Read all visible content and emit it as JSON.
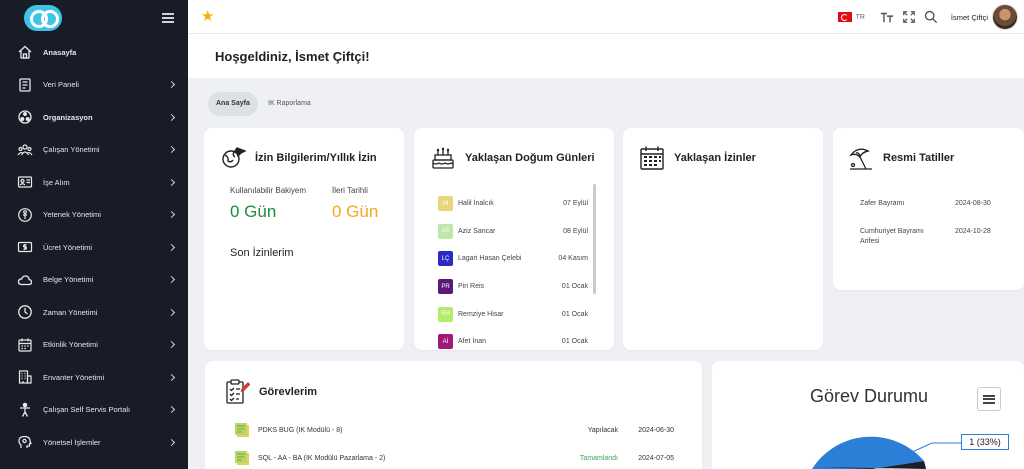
{
  "sidebar": {
    "items": [
      {
        "label": "Anasayfa",
        "icon": "home-icon"
      },
      {
        "label": "Veri Paneli",
        "icon": "dashboard-icon"
      },
      {
        "label": "Organizasyon",
        "icon": "organization-icon"
      },
      {
        "label": "Çalışan Yönetimi",
        "icon": "employees-icon"
      },
      {
        "label": "İşe Alım",
        "icon": "id-card-icon"
      },
      {
        "label": "Yetenek Yönetimi",
        "icon": "talent-icon"
      },
      {
        "label": "Ücret Yönetimi",
        "icon": "money-icon"
      },
      {
        "label": "Belge Yönetimi",
        "icon": "cloud-icon"
      },
      {
        "label": "Zaman Yönetimi",
        "icon": "clock-icon"
      },
      {
        "label": "Etkinlik Yönetimi",
        "icon": "calendar-icon"
      },
      {
        "label": "Envanter Yönetimi",
        "icon": "building-icon"
      },
      {
        "label": "Çalışan Self Servis Portalı",
        "icon": "person-icon"
      },
      {
        "label": "Yönetsel İşlemler",
        "icon": "settings-brain-icon"
      }
    ]
  },
  "topbar": {
    "lang": "TR",
    "user_name": "İsmet Çiftçi"
  },
  "welcome": "Hoşgeldiniz, İsmet Çiftçi!",
  "tabs": [
    "Ana Sayfa",
    "IK Raporlama"
  ],
  "leave": {
    "title": "İzin Bilgilerim/Yıllık İzin",
    "available_label": "Kullanılabilir Bakiyem",
    "available_value": "0 Gün",
    "future_label": "İleri Tarihli",
    "future_value": "0 Gün",
    "recent_title": "Son İzinlerim",
    "available_color": "#1e8e3e",
    "future_color": "#f5a623"
  },
  "birthdays": {
    "title": "Yaklaşan Doğum Günleri",
    "items": [
      {
        "initials": "Hİ",
        "name": "Halil İnalcık",
        "date": "07 Eylül",
        "color": "#e8d77a"
      },
      {
        "initials": "AS",
        "name": "Aziz Sancar",
        "date": "08 Eylül",
        "color": "#bfe8a8"
      },
      {
        "initials": "LÇ",
        "name": "Lagari Hasan Çelebi",
        "date": "04 Kasım",
        "color": "#2b2bc4"
      },
      {
        "initials": "PR",
        "name": "Piri Reis",
        "date": "01 Ocak",
        "color": "#5b1a78"
      },
      {
        "initials": "RH",
        "name": "Remziye Hisar",
        "date": "01 Ocak",
        "color": "#b6ec6a"
      },
      {
        "initials": "Aİ",
        "name": "Afet İnan",
        "date": "01 Ocak",
        "color": "#a0187a"
      }
    ]
  },
  "upcoming_leaves": {
    "title": "Yaklaşan İzinler"
  },
  "holidays": {
    "title": "Resmi Tatiller",
    "items": [
      {
        "name": "Zafer Bayramı",
        "date": "2024-08-30"
      },
      {
        "name": "Cumhuriyet Bayramı Arifesi",
        "date": "2024-10-28"
      }
    ]
  },
  "tasks": {
    "title": "Görevlerim",
    "items": [
      {
        "name": "PDKS BUG (IK Modülü - 8)",
        "status": "Yapılacak",
        "date": "2024-06-30",
        "status_color": "#333333"
      },
      {
        "name": "SQL - AA - BA (IK Modülü Pazarlama - 2)",
        "status": "Tamamlandı",
        "date": "2024-07-05",
        "status_color": "#3aa55a"
      }
    ]
  },
  "task_status_chart": {
    "title": "Görev Durumu",
    "label": "1 (33%)"
  },
  "chart_data": {
    "type": "pie",
    "title": "Görev Durumu",
    "slices": [
      {
        "value": 1,
        "percent": 33,
        "label": "1 (33%)",
        "color": "#2b7fd6"
      }
    ]
  }
}
